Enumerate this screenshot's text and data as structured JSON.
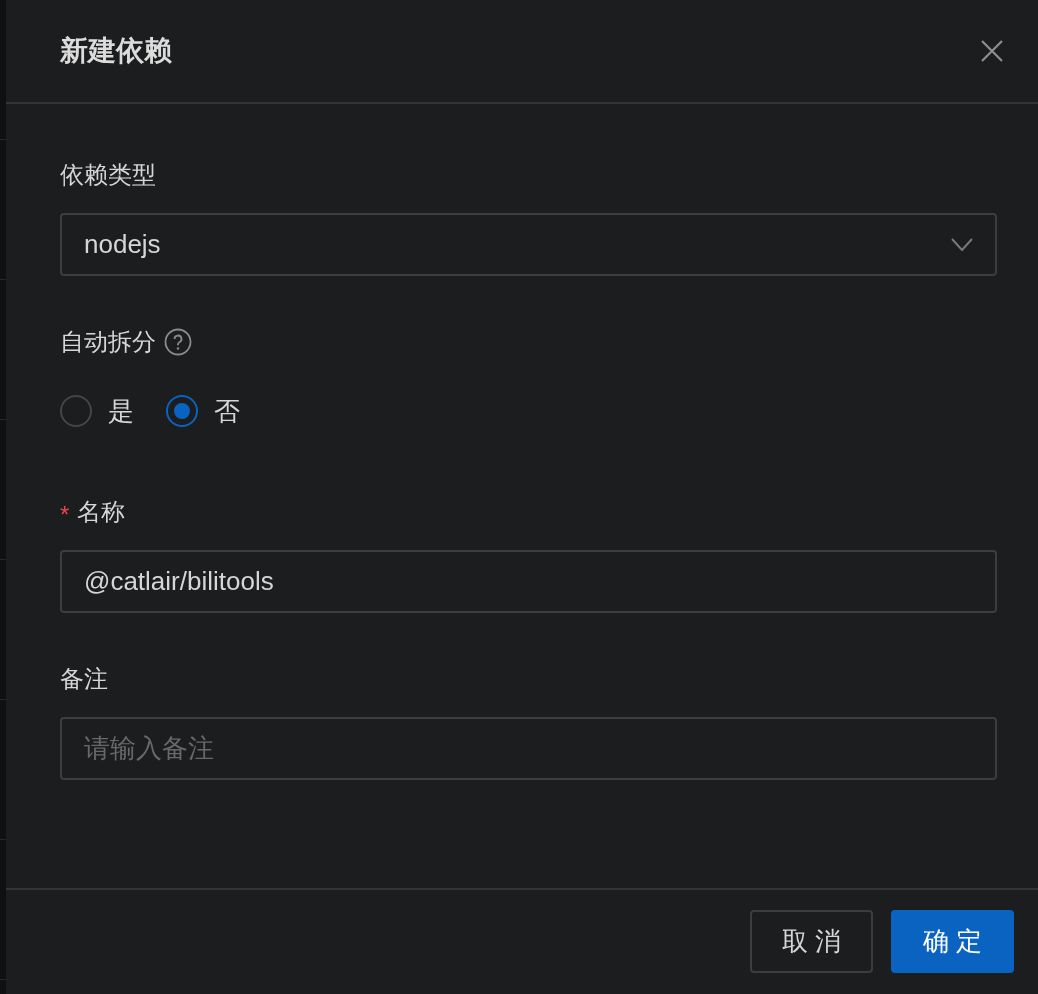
{
  "dialog": {
    "title": "新建依赖"
  },
  "fields": [
    {
      "kind": "select",
      "label": "依赖类型",
      "value": "nodejs"
    },
    {
      "kind": "radio",
      "label": "自动拆分",
      "help_icon": true,
      "options": [
        {
          "label": "是",
          "selected": false
        },
        {
          "label": "否",
          "selected": true
        }
      ]
    },
    {
      "kind": "input",
      "label": "名称",
      "required_mark": "*",
      "value": "@catlair/bilitools"
    },
    {
      "kind": "input",
      "label": "备注",
      "placeholder": "请输入备注"
    }
  ],
  "buttons": [
    {
      "label": "取 消",
      "kind": "default"
    },
    {
      "label": "确 定",
      "kind": "primary"
    }
  ]
}
